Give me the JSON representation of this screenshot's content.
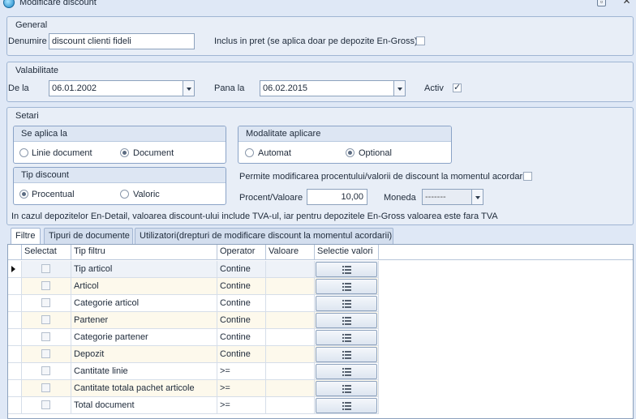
{
  "window": {
    "title": "Modificare discount"
  },
  "general": {
    "group_title": "General",
    "denumire_label": "Denumire",
    "denumire_value": "discount clienti fideli",
    "inclus_label": "Inclus in pret (se aplica doar pe depozite En-Gross)",
    "inclus_checked": false
  },
  "valabilitate": {
    "group_title": "Valabilitate",
    "de_la_label": "De la",
    "de_la_value": "06.01.2002",
    "pana_la_label": "Pana la",
    "pana_la_value": "06.02.2015",
    "activ_label": "Activ",
    "activ_checked": true
  },
  "setari": {
    "group_title": "Setari",
    "se_aplica_la": {
      "title": "Se aplica la",
      "option_linie": "Linie document",
      "option_document": "Document",
      "selected": "Document"
    },
    "modalitate": {
      "title": "Modalitate aplicare",
      "option_automat": "Automat",
      "option_optional": "Optional",
      "selected": "Optional"
    },
    "tip_discount": {
      "title": "Tip discount",
      "option_procentual": "Procentual",
      "option_valoric": "Valoric",
      "selected": "Procentual"
    },
    "permite_label": "Permite modificarea procentului/valorii de discount la momentul acordarii",
    "permite_checked": false,
    "procent_label": "Procent/Valoare",
    "procent_value": "10,00",
    "moneda_label": "Moneda",
    "moneda_value": "-------",
    "note": "In cazul depozitelor En-Detail, valoarea discount-ului include TVA-ul, iar pentru depozitele En-Gross valoarea este fara TVA"
  },
  "tabs": [
    {
      "label": "Filtre",
      "active": true
    },
    {
      "label": "Tipuri de documente",
      "active": false
    },
    {
      "label": "Utilizatori(drepturi de modificare discount la momentul acordarii)",
      "active": false
    }
  ],
  "grid": {
    "columns": [
      "Selectat",
      "Tip filtru",
      "Operator",
      "Valoare",
      "Selectie valori"
    ],
    "rows": [
      {
        "tip": "Tip articol",
        "operator": "Contine",
        "valoare": "",
        "selectat": false
      },
      {
        "tip": "Articol",
        "operator": "Contine",
        "valoare": "",
        "selectat": false
      },
      {
        "tip": "Categorie articol",
        "operator": "Contine",
        "valoare": "",
        "selectat": false
      },
      {
        "tip": "Partener",
        "operator": "Contine",
        "valoare": "",
        "selectat": false
      },
      {
        "tip": "Categorie partener",
        "operator": "Contine",
        "valoare": "",
        "selectat": false
      },
      {
        "tip": "Depozit",
        "operator": "Contine",
        "valoare": "",
        "selectat": false
      },
      {
        "tip": "Cantitate linie",
        "operator": ">=",
        "valoare": "",
        "selectat": false
      },
      {
        "tip": "Cantitate totala pachet articole",
        "operator": ">=",
        "valoare": "",
        "selectat": false
      },
      {
        "tip": "Total document",
        "operator": ">=",
        "valoare": "",
        "selectat": false
      }
    ],
    "current_row": 0
  },
  "icons": {
    "title_icon": "app-globe-icon",
    "restore": "restore-window-icon",
    "close": "close-window-icon",
    "dropdown": "chevron-down-icon",
    "list": "list-icon",
    "row_indicator": "current-row-arrow-icon"
  },
  "colors": {
    "background": "#dfe8f6",
    "border": "#8da2bd",
    "alt_row": "#fdf9ec"
  }
}
